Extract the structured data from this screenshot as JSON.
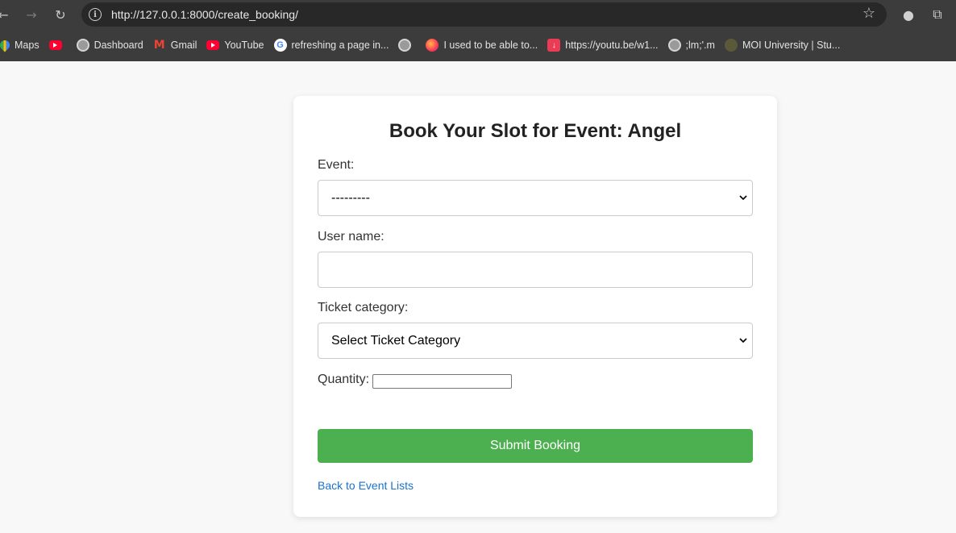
{
  "browser": {
    "url": "http://127.0.0.1:8000/create_booking/",
    "icons": {
      "back": "back-arrow-icon",
      "forward": "forward-arrow-icon",
      "reload": "reload-icon",
      "site_info": "info-icon",
      "star": "star-icon",
      "extension": "extension-icon",
      "puzzle": "puzzle-icon"
    },
    "bookmarks": [
      {
        "label": "Maps",
        "icon": "maps-icon"
      },
      {
        "label": "",
        "icon": "youtube-icon"
      },
      {
        "label": "Dashboard",
        "icon": "globe-icon"
      },
      {
        "label": "Gmail",
        "icon": "gmail-icon"
      },
      {
        "label": "YouTube",
        "icon": "youtube-icon"
      },
      {
        "label": "refreshing a page in...",
        "icon": "google-icon"
      },
      {
        "label": "",
        "icon": "globe-icon"
      },
      {
        "label": "I used to be able to...",
        "icon": "firefox-icon"
      },
      {
        "label": "https://youtu.be/w1...",
        "icon": "download-icon"
      },
      {
        "label": ";lm;'.m",
        "icon": "globe-icon"
      },
      {
        "label": "MOI University | Stu...",
        "icon": "moi-icon"
      }
    ]
  },
  "page": {
    "title": "Book Your Slot for Event: Angel",
    "event_label": "Event:",
    "event_value": "---------",
    "username_label": "User name:",
    "username_value": "",
    "ticket_label": "Ticket category:",
    "ticket_value": "Select Ticket Category",
    "quantity_label": "Quantity:",
    "quantity_value": "",
    "submit_label": "Submit Booking",
    "back_link": "Back to Event Lists"
  },
  "colors": {
    "submit": "#4caf50",
    "link": "#1a73c8"
  }
}
